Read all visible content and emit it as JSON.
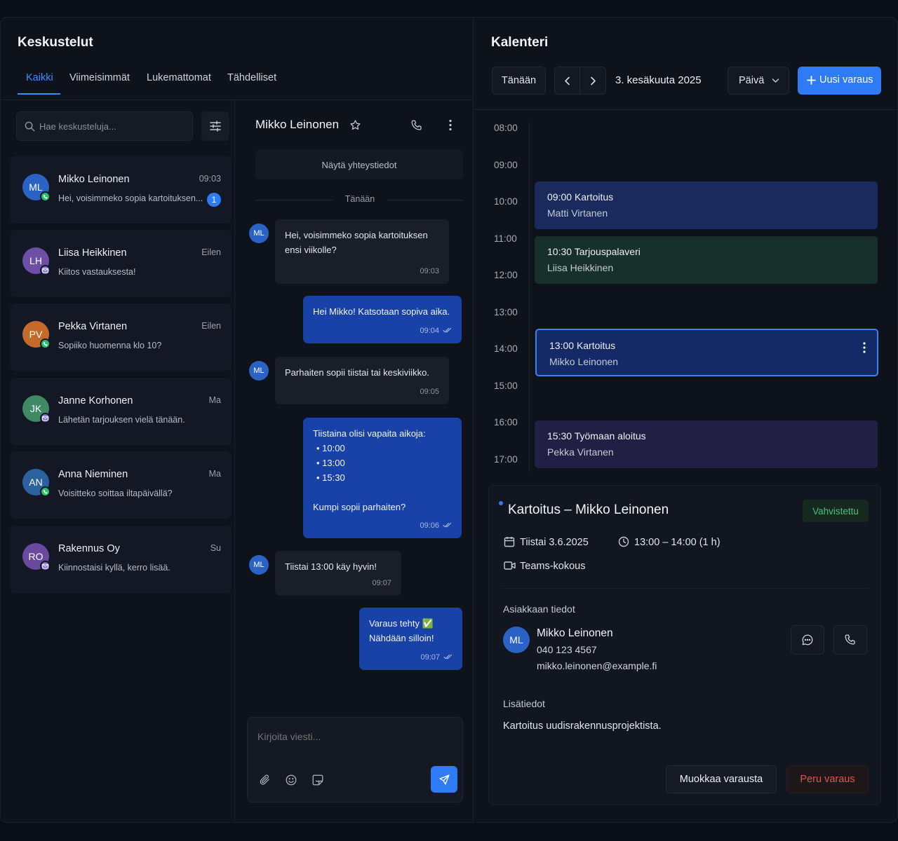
{
  "conversations_panel": {
    "title": "Keskustelut",
    "tabs": [
      "Kaikki",
      "Viimeisimmät",
      "Lukemattomat",
      "Tähdelliset"
    ],
    "active_tab": "Kaikki",
    "search_placeholder": "Hae keskusteluja...",
    "items": [
      {
        "initials": "ML",
        "name": "Mikko Leinonen",
        "time": "09:03",
        "preview": "Hei, voisimmeko sopia kartoituksen...",
        "unread": "1",
        "channel": "whatsapp",
        "avatar_color": "#2a63c4"
      },
      {
        "initials": "LH",
        "name": "Liisa Heikkinen",
        "time": "Eilen",
        "preview": "Kiitos vastauksesta!",
        "channel": "email",
        "avatar_color": "#6e4fa8"
      },
      {
        "initials": "PV",
        "name": "Pekka Virtanen",
        "time": "Eilen",
        "preview": "Sopiiko huomenna klo 10?",
        "channel": "whatsapp",
        "avatar_color": "#c46a2a"
      },
      {
        "initials": "JK",
        "name": "Janne Korhonen",
        "time": "Ma",
        "preview": "Lähetän tarjouksen vielä tänään.",
        "channel": "email",
        "avatar_color": "#3f8a64"
      },
      {
        "initials": "AN",
        "name": "Anna Nieminen",
        "time": "Ma",
        "preview": "Voisitteko soittaa iltapäivällä?",
        "channel": "whatsapp",
        "avatar_color": "#2a62a0"
      },
      {
        "initials": "RO",
        "name": "Rakennus Oy",
        "time": "Su",
        "preview": "Kiinnostaisi kyllä, kerro lisää.",
        "channel": "email",
        "avatar_color": "#6a4aa0"
      }
    ]
  },
  "chat": {
    "contact_name": "Mikko Leinonen",
    "show_contact_label": "Näytä yhteystiedot",
    "day_label": "Tänään",
    "avatar_initials": "ML",
    "messages": [
      {
        "dir": "in",
        "lines": [
          "Hei, voisimmeko sopia kartoituksen",
          "ensi viikolle?"
        ],
        "time": "09:03"
      },
      {
        "dir": "out",
        "lines": [
          "Hei Mikko! Katsotaan sopiva aika."
        ],
        "time": "09:04"
      },
      {
        "dir": "in",
        "lines": [
          "Parhaiten sopii tiistai tai keskiviikko."
        ],
        "time": "09:05"
      },
      {
        "dir": "out",
        "lines": [
          "Tiistaina olisi vapaita aikoja:",
          "• 10:00",
          "• 13:00",
          "• 15:30",
          "",
          "Kumpi sopii parhaiten?"
        ],
        "time": "09:06"
      },
      {
        "dir": "in",
        "lines": [
          "Tiistai 13:00 käy hyvin!"
        ],
        "time": "09:07"
      },
      {
        "dir": "out",
        "lines": [
          "Varaus tehty ✅",
          "Nähdään silloin!"
        ],
        "time": "09:07"
      }
    ],
    "input_placeholder": "Kirjoita viesti..."
  },
  "calendar": {
    "title": "Kalenteri",
    "today_button": "Tänään",
    "date_label": "3. kesäkuuta 2025",
    "view_select": "Päivä",
    "new_booking_button": "Uusi varaus",
    "time_labels": [
      "08:00",
      "09:00",
      "10:00",
      "11:00",
      "12:00",
      "13:00",
      "14:00",
      "15:00",
      "16:00",
      "17:00"
    ],
    "events": [
      {
        "time": "09:00",
        "title": "Kartoitus",
        "person": "Matti Virtanen",
        "color": "#1a2a5c"
      },
      {
        "time": "10:30",
        "title": "Tarjouspalaveri",
        "person": "Liisa Heikkinen",
        "color": "#18302b"
      },
      {
        "time": "13:00",
        "title": "Kartoitus",
        "person": "Mikko Leinonen",
        "color": "#142a66",
        "selected": true
      },
      {
        "time": "15:30",
        "title": "Työmaan aloitus",
        "person": "Pekka Virtanen",
        "color": "#221f45"
      }
    ]
  },
  "booking_detail": {
    "title": "Kartoitus – Mikko Leinonen",
    "status": "Vahvistettu",
    "date": "Tiistai 3.6.2025",
    "time": "13:00 – 14:00 (1 h)",
    "meeting_type": "Teams-kokous",
    "customer_section": "Asiakkaan tiedot",
    "customer": {
      "initials": "ML",
      "name": "Mikko Leinonen",
      "phone": "040 123 4567",
      "email": "mikko.leinonen@example.fi"
    },
    "notes_section": "Lisätiedot",
    "notes": "Kartoitus uudisrakennusprojektista.",
    "edit_button": "Muokkaa varausta",
    "cancel_button": "Peru varaus"
  },
  "colors": {
    "accent": "#2f7bf5",
    "whatsapp": "#25c26a",
    "confirmed": "#4cc07f",
    "cancel": "#e5534b"
  }
}
